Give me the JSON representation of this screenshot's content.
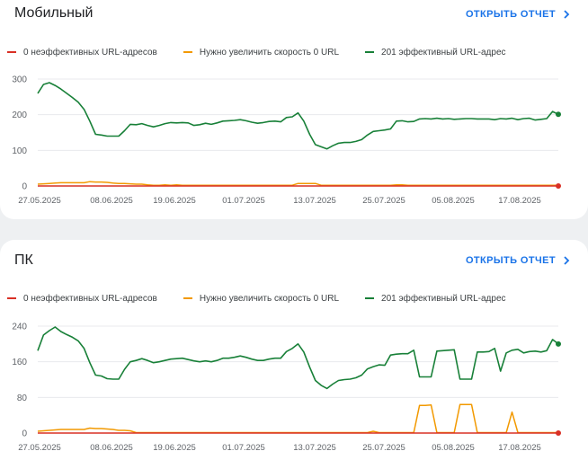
{
  "colors": {
    "red": "#d93025",
    "orange": "#f29900",
    "green": "#188038",
    "grid": "#e8eaed",
    "axis": "#9aa0a6",
    "link": "#1a73e8"
  },
  "open_report_label": "ОТКРЫТЬ ОТЧЕТ",
  "chevron_icon": "chevron-right-icon",
  "chart_data": [
    {
      "type": "line",
      "title": "Мобильный",
      "legend": [
        "0 неэффективных URL-адресов",
        "Нужно увеличить скорость 0 URL",
        "201 эффективный URL-адрес"
      ],
      "x_tick_labels": [
        "27.05.2025",
        "08.06.2025",
        "19.06.2025",
        "01.07.2025",
        "13.07.2025",
        "25.07.2025",
        "05.08.2025",
        "17.08.2025"
      ],
      "y_ticks": [
        0,
        100,
        200,
        300
      ],
      "ylim": [
        0,
        300
      ],
      "series": [
        {
          "name": "0 неэффективных URL-адресов",
          "color": "#d93025",
          "values": [
            0,
            0,
            0,
            0,
            0,
            0,
            0,
            0,
            0,
            0,
            0,
            0,
            0,
            0,
            0,
            0,
            0,
            0,
            0,
            0,
            0,
            0,
            0,
            0,
            0,
            0,
            0,
            0,
            0,
            0,
            0,
            0,
            0,
            0,
            0,
            0,
            0,
            0,
            0,
            0,
            0,
            0,
            0,
            0,
            0,
            0,
            0,
            0,
            0,
            0,
            0,
            0,
            0,
            0,
            0,
            0,
            0,
            0,
            0,
            0,
            0,
            0,
            0,
            0,
            0,
            0,
            0,
            0,
            0,
            0,
            0,
            0,
            0,
            0,
            0,
            0,
            0,
            0,
            0,
            0,
            0,
            0,
            0,
            0,
            0,
            0,
            0,
            0,
            0,
            0,
            0
          ]
        },
        {
          "name": "Нужно увеличить скорость 0 URL",
          "color": "#f29900",
          "values": [
            5,
            6,
            7,
            8,
            9,
            9,
            9,
            9,
            9,
            12,
            11,
            11,
            10,
            8,
            7,
            7,
            6,
            5,
            5,
            3,
            2,
            2,
            3,
            2,
            3,
            2,
            2,
            2,
            2,
            2,
            2,
            2,
            2,
            2,
            2,
            2,
            2,
            2,
            2,
            2,
            2,
            2,
            2,
            2,
            2,
            7,
            7,
            7,
            7,
            2,
            2,
            2,
            2,
            2,
            2,
            2,
            2,
            2,
            2,
            2,
            2,
            2,
            3,
            3,
            2,
            2,
            2,
            2,
            2,
            2,
            2,
            2,
            2,
            2,
            2,
            2,
            2,
            2,
            2,
            2,
            2,
            2,
            2,
            2,
            2,
            2,
            2,
            2,
            2,
            2,
            2
          ]
        },
        {
          "name": "201 эффективный URL-адрес",
          "color": "#188038",
          "values": [
            260,
            285,
            290,
            282,
            272,
            260,
            248,
            235,
            215,
            182,
            145,
            143,
            140,
            140,
            140,
            155,
            173,
            172,
            175,
            170,
            166,
            170,
            175,
            178,
            177,
            178,
            177,
            170,
            172,
            176,
            173,
            177,
            182,
            183,
            184,
            186,
            183,
            179,
            176,
            178,
            181,
            182,
            180,
            192,
            194,
            205,
            182,
            145,
            116,
            110,
            104,
            113,
            120,
            122,
            122,
            125,
            130,
            143,
            153,
            155,
            157,
            160,
            182,
            183,
            180,
            181,
            188,
            189,
            188,
            190,
            188,
            189,
            187,
            188,
            189,
            189,
            188,
            188,
            188,
            186,
            189,
            188,
            190,
            186,
            189,
            190,
            185,
            187,
            189,
            209,
            201
          ]
        }
      ]
    },
    {
      "type": "line",
      "title": "ПК",
      "legend": [
        "0 неэффективных URL-адресов",
        "Нужно увеличить скорость 0 URL",
        "201 эффективный URL-адрес"
      ],
      "x_tick_labels": [
        "27.05.2025",
        "08.06.2025",
        "19.06.2025",
        "01.07.2025",
        "13.07.2025",
        "25.07.2025",
        "05.08.2025",
        "17.08.2025"
      ],
      "y_ticks": [
        0,
        80,
        160,
        240
      ],
      "ylim": [
        0,
        240
      ],
      "series": [
        {
          "name": "0 неэффективных URL-адресов",
          "color": "#d93025",
          "values": [
            0,
            0,
            0,
            0,
            0,
            0,
            0,
            0,
            0,
            0,
            0,
            0,
            0,
            0,
            0,
            0,
            0,
            0,
            0,
            0,
            0,
            0,
            0,
            0,
            0,
            0,
            0,
            0,
            0,
            0,
            0,
            0,
            0,
            0,
            0,
            0,
            0,
            0,
            0,
            0,
            0,
            0,
            0,
            0,
            0,
            0,
            0,
            0,
            0,
            0,
            0,
            0,
            0,
            0,
            0,
            0,
            0,
            0,
            0,
            0,
            0,
            0,
            0,
            0,
            0,
            0,
            0,
            0,
            0,
            0,
            0,
            0,
            0,
            0,
            0,
            0,
            0,
            0,
            0,
            0,
            0,
            0,
            0,
            0,
            0,
            0,
            0,
            0,
            0,
            0,
            0
          ]
        },
        {
          "name": "Нужно увеличить скорость 0 URL",
          "color": "#f29900",
          "values": [
            4,
            5,
            6,
            7,
            8,
            8,
            8,
            8,
            8,
            11,
            10,
            10,
            9,
            8,
            6,
            6,
            5,
            1,
            1,
            1,
            1,
            1,
            1,
            1,
            1,
            1,
            1,
            1,
            1,
            1,
            1,
            1,
            1,
            1,
            1,
            1,
            1,
            1,
            1,
            1,
            1,
            1,
            1,
            1,
            1,
            1,
            1,
            1,
            1,
            1,
            1,
            1,
            1,
            1,
            1,
            1,
            1,
            1,
            4,
            1,
            1,
            1,
            1,
            1,
            1,
            1,
            62,
            62,
            63,
            1,
            1,
            1,
            1,
            64,
            64,
            64,
            1,
            1,
            1,
            1,
            1,
            1,
            47,
            1,
            1,
            1,
            1,
            1,
            1,
            1,
            1
          ]
        },
        {
          "name": "201 эффективный URL-адрес",
          "color": "#188038",
          "values": [
            185,
            220,
            230,
            238,
            228,
            221,
            215,
            207,
            190,
            158,
            130,
            128,
            122,
            121,
            121,
            143,
            160,
            163,
            167,
            163,
            158,
            160,
            163,
            166,
            167,
            168,
            165,
            162,
            160,
            162,
            160,
            163,
            168,
            168,
            170,
            173,
            170,
            166,
            163,
            163,
            166,
            168,
            168,
            183,
            190,
            200,
            182,
            148,
            118,
            107,
            100,
            110,
            118,
            120,
            121,
            124,
            130,
            144,
            149,
            153,
            152,
            175,
            177,
            178,
            178,
            186,
            126,
            126,
            126,
            184,
            185,
            186,
            187,
            121,
            121,
            121,
            182,
            182,
            183,
            190,
            139,
            180,
            186,
            188,
            180,
            183,
            184,
            182,
            185,
            210,
            200
          ]
        }
      ]
    }
  ]
}
